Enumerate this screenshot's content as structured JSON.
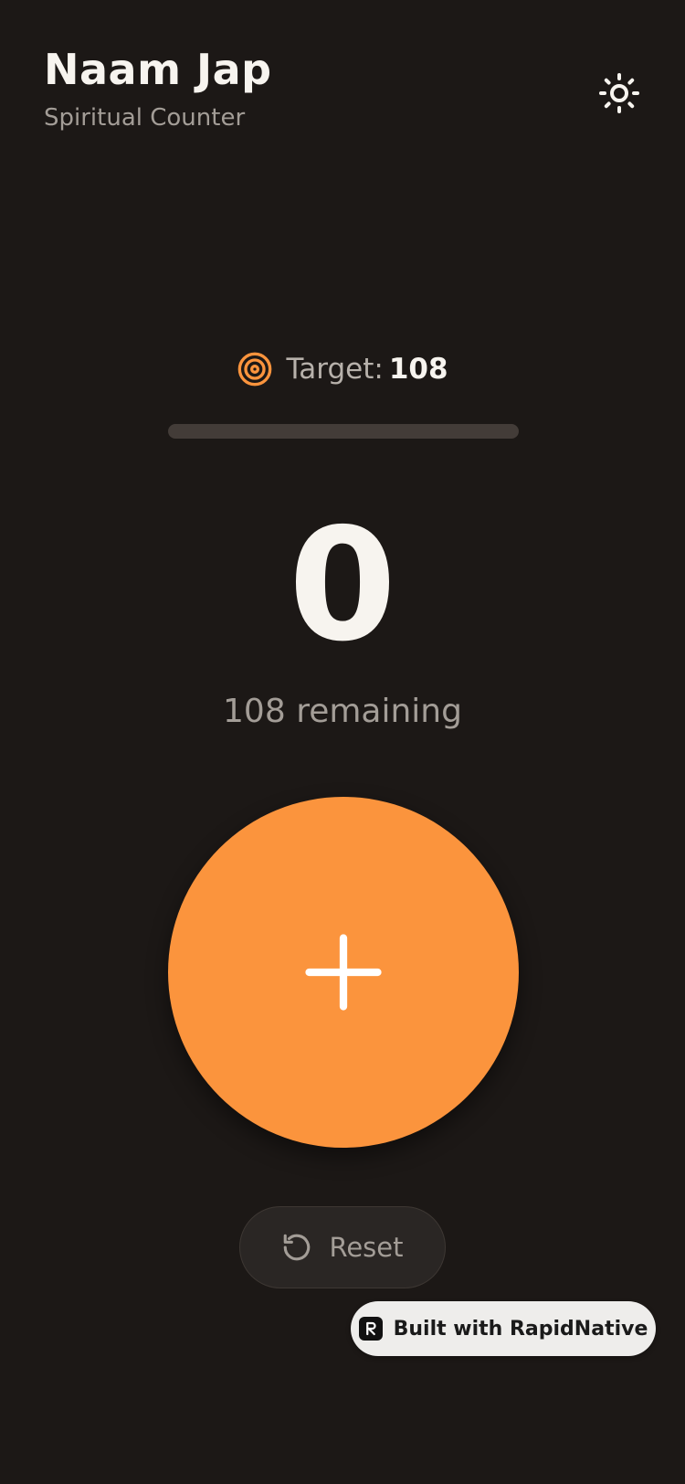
{
  "header": {
    "title": "Naam Jap",
    "subtitle": "Spiritual Counter",
    "theme_icon": "sun-icon"
  },
  "target": {
    "label": "Target:",
    "value": "108",
    "icon": "target-icon"
  },
  "progress": {
    "fraction": 0
  },
  "counter": {
    "count": "0",
    "remaining_text": "108 remaining"
  },
  "increment_button": {
    "icon": "plus-icon"
  },
  "reset_button": {
    "label": "Reset",
    "icon": "rotate-ccw-icon"
  },
  "badge": {
    "label": "Built with RapidNative",
    "icon": "rapidnative-logo-icon"
  },
  "colors": {
    "background": "#1c1816",
    "accent": "#fb943d",
    "text_primary": "#f7f4ef",
    "text_secondary": "#a39d97",
    "track": "#433c38"
  }
}
